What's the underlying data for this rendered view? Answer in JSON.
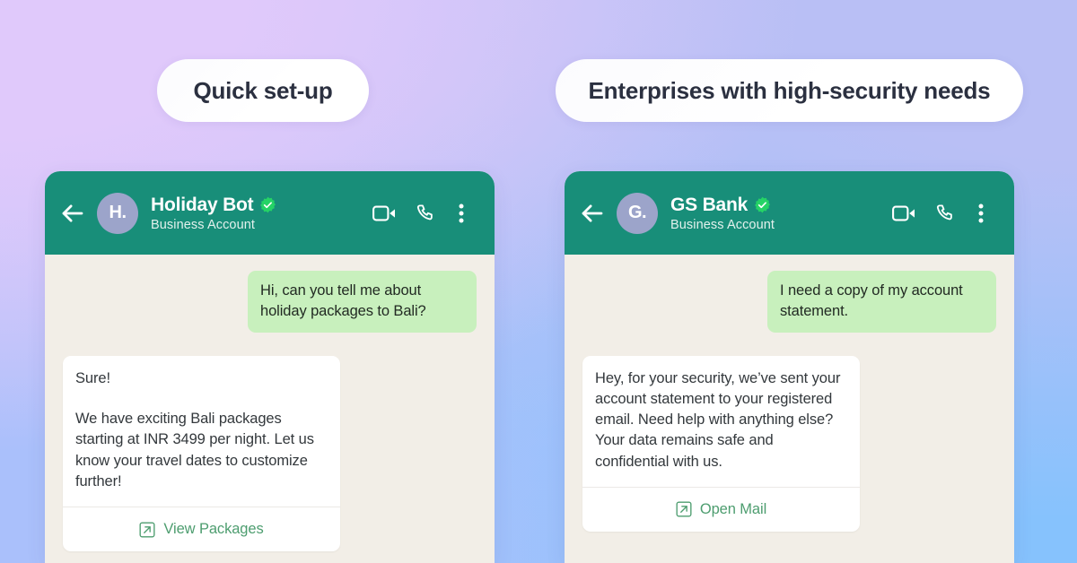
{
  "theme": {
    "header_green": "#188E79",
    "chat_bg": "#F2EEE7",
    "outgoing_bubble": "#C8F0BD",
    "link_green": "#4D9D6F",
    "avatar_bg": "#9CA4CA",
    "verified_green": "#25D366"
  },
  "pills": {
    "left": "Quick set-up",
    "right": "Enterprises with high-security needs"
  },
  "conversations": [
    {
      "id": "holiday-bot",
      "header": {
        "back_icon": "back-arrow-icon",
        "avatar_initials": "H.",
        "name": "Holiday Bot",
        "verified_icon": "verified-badge-icon",
        "subtitle": "Business Account",
        "actions": [
          {
            "icon": "video-call-icon",
            "label": "Video call"
          },
          {
            "icon": "voice-call-icon",
            "label": "Voice call"
          },
          {
            "icon": "more-options-icon",
            "label": "More options"
          }
        ]
      },
      "messages": {
        "outgoing": "Hi, can you tell me about holiday packages to Bali?",
        "card": {
          "paragraphs": [
            "Sure!",
            "We have exciting Bali packages starting at INR 3499 per night. Let us know your travel dates to customize further!"
          ],
          "action_icon": "external-link-icon",
          "action_label": "View Packages"
        }
      }
    },
    {
      "id": "gs-bank",
      "header": {
        "back_icon": "back-arrow-icon",
        "avatar_initials": "G.",
        "name": "GS Bank",
        "verified_icon": "verified-badge-icon",
        "subtitle": "Business Account",
        "actions": [
          {
            "icon": "video-call-icon",
            "label": "Video call"
          },
          {
            "icon": "voice-call-icon",
            "label": "Voice call"
          },
          {
            "icon": "more-options-icon",
            "label": "More options"
          }
        ]
      },
      "messages": {
        "outgoing": "I need a copy of my account statement.",
        "card": {
          "paragraphs": [
            "Hey, for your security, we’ve sent your account statement to your registered email. Need help with anything else? Your data remains safe and confidential with us."
          ],
          "action_icon": "external-link-icon",
          "action_label": "Open Mail"
        }
      }
    }
  ]
}
